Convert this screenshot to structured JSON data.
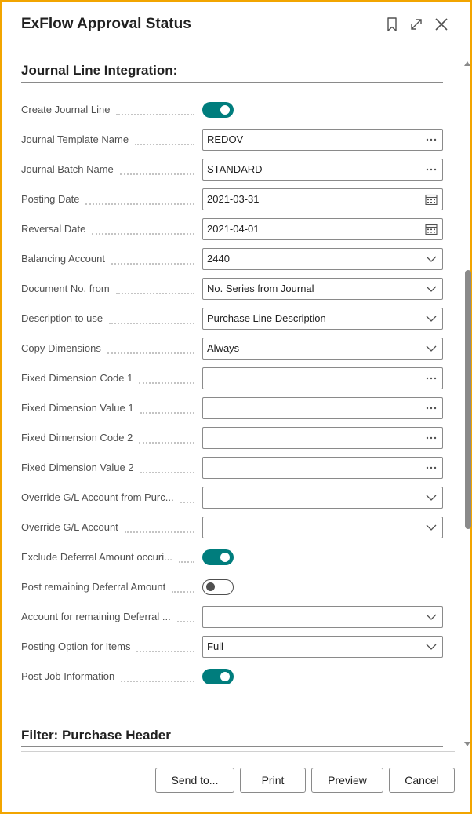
{
  "window": {
    "title": "ExFlow Approval Status"
  },
  "sections": {
    "journal": "Journal Line Integration:",
    "filter": "Filter: Purchase Header"
  },
  "fields": [
    {
      "label": "Create Journal Line",
      "type": "toggle",
      "on": true
    },
    {
      "label": "Journal Template Name",
      "type": "lookup",
      "value": "REDOV"
    },
    {
      "label": "Journal Batch Name",
      "type": "lookup",
      "value": "STANDARD"
    },
    {
      "label": "Posting Date",
      "type": "date",
      "value": "2021-03-31"
    },
    {
      "label": "Reversal Date",
      "type": "date",
      "value": "2021-04-01"
    },
    {
      "label": "Balancing Account",
      "type": "dropdown",
      "value": "2440"
    },
    {
      "label": "Document No. from",
      "type": "dropdown",
      "value": "No. Series from Journal"
    },
    {
      "label": "Description to use",
      "type": "dropdown",
      "value": "Purchase Line Description"
    },
    {
      "label": "Copy Dimensions",
      "type": "dropdown",
      "value": "Always"
    },
    {
      "label": "Fixed Dimension Code 1",
      "type": "lookup",
      "value": ""
    },
    {
      "label": "Fixed Dimension Value 1",
      "type": "lookup",
      "value": ""
    },
    {
      "label": "Fixed Dimension Code 2",
      "type": "lookup",
      "value": ""
    },
    {
      "label": "Fixed Dimension Value 2",
      "type": "lookup",
      "value": ""
    },
    {
      "label": "Override G/L Account from Purc...",
      "type": "dropdown",
      "value": ""
    },
    {
      "label": "Override G/L Account",
      "type": "dropdown",
      "value": ""
    },
    {
      "label": "Exclude Deferral Amount occuri...",
      "type": "toggle",
      "on": true
    },
    {
      "label": "Post remaining Deferral Amount",
      "type": "toggle",
      "on": false
    },
    {
      "label": "Account for remaining Deferral ...",
      "type": "dropdown",
      "value": ""
    },
    {
      "label": "Posting Option for Items",
      "type": "dropdown",
      "value": "Full"
    },
    {
      "label": "Post Job Information",
      "type": "toggle",
      "on": true
    }
  ],
  "buttons": {
    "send_to": "Send to...",
    "print": "Print",
    "preview": "Preview",
    "cancel": "Cancel"
  },
  "icons": {
    "bookmark": "bookmark-icon",
    "expand": "expand-icon",
    "close": "close-icon",
    "lookup": "ellipsis-icon",
    "date": "calendar-icon",
    "dropdown": "chevron-down-icon"
  },
  "colors": {
    "accent": "#007d7d",
    "frame_border": "#f2a500"
  }
}
